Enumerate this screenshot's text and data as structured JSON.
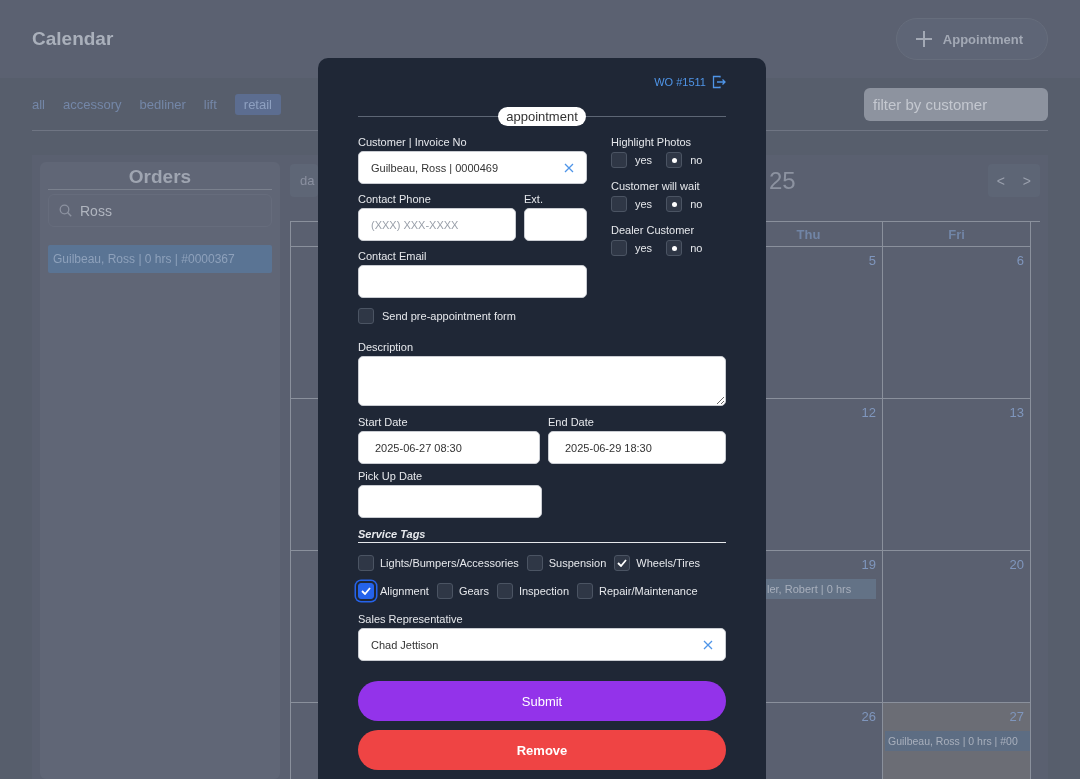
{
  "header": {
    "title": "Calendar",
    "add_button": {
      "label": "Appointment"
    }
  },
  "filters": {
    "tabs": [
      {
        "label": "all",
        "selected": false
      },
      {
        "label": "accessory",
        "selected": false
      },
      {
        "label": "bedliner",
        "selected": false
      },
      {
        "label": "lift",
        "selected": false
      },
      {
        "label": "retail",
        "selected": true
      }
    ],
    "search": {
      "placeholder": "filter by customer"
    }
  },
  "orders": {
    "title": "Orders",
    "search": {
      "value": "Ross"
    },
    "items": [
      {
        "label": "Guilbeau, Ross | 0 hrs | #0000367",
        "selected": true
      }
    ]
  },
  "calendar": {
    "view_button": "da",
    "title": "25",
    "nav": [
      "<",
      ">"
    ],
    "columns": [
      "Thu",
      "Fri"
    ],
    "weeks": [
      {
        "days": [
          {
            "date": "5",
            "today": false
          },
          {
            "date": "6",
            "today": false
          }
        ]
      },
      {
        "days": [
          {
            "date": "12",
            "today": false
          },
          {
            "date": "13",
            "today": false
          }
        ]
      },
      {
        "days": [
          {
            "date": "19",
            "today": false,
            "events": [
              {
                "label": "ler, Robert | 0 hrs"
              }
            ]
          },
          {
            "date": "20",
            "today": false
          }
        ]
      },
      {
        "days": [
          {
            "date": "26",
            "today": false
          },
          {
            "date": "27",
            "today": true,
            "events": [
              {
                "label": "Guilbeau, Ross | 0 hrs | #00"
              }
            ]
          }
        ]
      }
    ]
  },
  "appointment": {
    "work_order": "WO #1511",
    "section": "appointment",
    "customer": {
      "label": "Customer | Invoice No",
      "value": "Guilbeau, Ross | 0000469"
    },
    "phone": {
      "label": "Contact Phone",
      "placeholder": "(XXX) XXX-XXXX"
    },
    "ext": {
      "label": "Ext."
    },
    "email": {
      "label": "Contact Email"
    },
    "toggles": [
      {
        "label": "Highlight Photos",
        "options": [
          {
            "label": "yes",
            "selected": false
          },
          {
            "label": "no",
            "selected": true
          }
        ]
      },
      {
        "label": "Customer will wait",
        "options": [
          {
            "label": "yes",
            "selected": false
          },
          {
            "label": "no",
            "selected": true
          }
        ]
      },
      {
        "label": "Dealer Customer",
        "options": [
          {
            "label": "yes",
            "selected": false
          },
          {
            "label": "no",
            "selected": true
          }
        ]
      }
    ],
    "pre_form": {
      "label": "Send pre-appointment form",
      "checked": false
    },
    "description": {
      "label": "Description"
    },
    "start": {
      "label": "Start Date",
      "value": "2025-06-27 08:30"
    },
    "end": {
      "label": "End Date",
      "value": "2025-06-29 18:30"
    },
    "pickup": {
      "label": "Pick Up Date"
    },
    "service_tags": {
      "title": "Service Tags",
      "rows": [
        {
          "tags": [
            {
              "label": "Lights/Bumpers/Accessories",
              "checked": false,
              "focused": false
            },
            {
              "label": "Suspension",
              "checked": false,
              "focused": false
            },
            {
              "label": "Wheels/Tires",
              "checked": true,
              "focused": false
            }
          ]
        },
        {
          "tags": [
            {
              "label": "Alignment",
              "checked": true,
              "focused": true
            },
            {
              "label": "Gears",
              "checked": false,
              "focused": false
            },
            {
              "label": "Inspection",
              "checked": false,
              "focused": false
            },
            {
              "label": "Repair/Maintenance",
              "checked": false,
              "focused": false
            }
          ]
        }
      ]
    },
    "sales_rep": {
      "label": "Sales Representative",
      "value": "Chad Jettison"
    },
    "buttons": [
      {
        "label": "Submit",
        "kind": "submit"
      },
      {
        "label": "Remove",
        "kind": "remove"
      }
    ]
  }
}
